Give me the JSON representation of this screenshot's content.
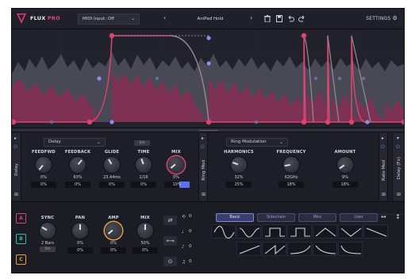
{
  "header": {
    "brand": "FLUX",
    "brand_suffix": "PRO",
    "midi_input": "MIDI Input: Off",
    "preset_name": "AniPad Hold",
    "settings_label": "SETTINGS",
    "prev_glyph": "‹",
    "next_glyph": "›",
    "chevron": "⌄",
    "icons": [
      "trash-icon",
      "save-icon",
      "undo-icon",
      "redo-icon",
      "gear-icon"
    ]
  },
  "effect1": {
    "strip_label": "Delay",
    "type": "Delay",
    "sync_value": "Sm",
    "knobs": [
      {
        "label": "FEEDFWD",
        "value": "0%",
        "box": "0%"
      },
      {
        "label": "FEEDBACK",
        "value": "63%",
        "box": "0%"
      },
      {
        "label": "GLIDE",
        "value": "23.44ms",
        "box": "0%"
      },
      {
        "label": "TIME",
        "value": "1/16",
        "box": "0%"
      },
      {
        "label": "MIX",
        "value": "0%",
        "box": "10%"
      }
    ]
  },
  "effect2": {
    "strip_label": "Ring Mod",
    "type": "Ring Modulation",
    "knobs": [
      {
        "label": "HARMONICS",
        "value": "32%",
        "box": "25%"
      },
      {
        "label": "FREQUENCY",
        "value": "62GHz",
        "box": "18%"
      },
      {
        "label": "AMOUNT",
        "value": "9%",
        "box": "18%"
      }
    ]
  },
  "right_strips": [
    "Rate Mod",
    "Delay (Fx)"
  ],
  "bottom": {
    "lanes": [
      {
        "label": "A",
        "color": "#e0436f"
      },
      {
        "label": "B",
        "color": "#2fbfb0"
      },
      {
        "label": "C",
        "color": "#e6a23a"
      }
    ],
    "knobs": [
      {
        "label": "SYNC",
        "value": "2 Bars",
        "box": "5m"
      },
      {
        "label": "PAN",
        "value": "0%",
        "box": "0%"
      },
      {
        "label": "AMP",
        "value": "0%",
        "box": "0%"
      },
      {
        "label": "MIX",
        "value": "50%",
        "box": "0%"
      }
    ],
    "step_values": [
      "0",
      "0",
      "0",
      "0"
    ],
    "tabs": [
      "Basic",
      "Sidechain",
      "Misc",
      "User"
    ],
    "shape_names": [
      "sine",
      "bump",
      "square",
      "pulse",
      "triangle",
      "valley",
      "ramp-down",
      "ramp-up",
      "saw-up",
      "sharp-up",
      "sharp-down",
      "decay"
    ]
  },
  "colors": {
    "accent": "#e0436f",
    "node_blue": "#8a8ef0",
    "knob_ring": "#e6a23a",
    "blue_value": "#5b7ff0"
  }
}
